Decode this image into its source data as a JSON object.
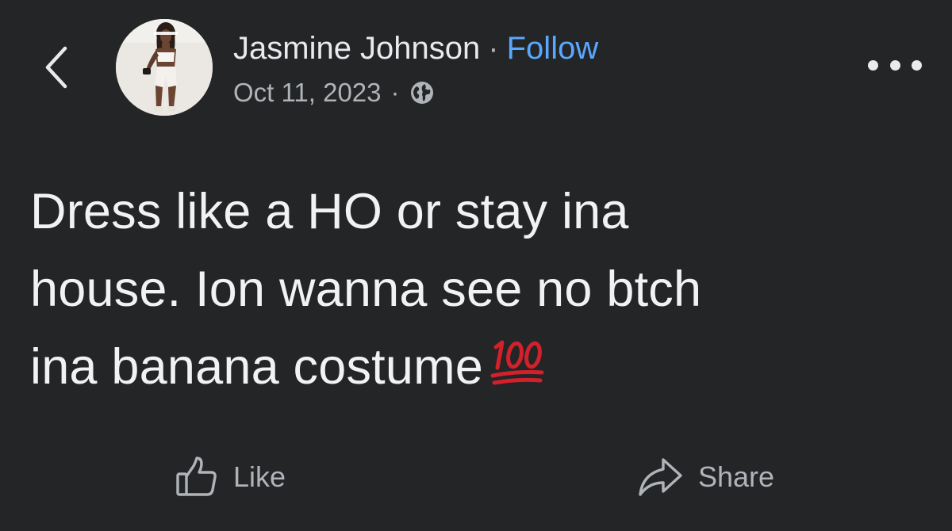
{
  "post": {
    "author_name": "Jasmine Johnson",
    "separator": "·",
    "follow_label": "Follow",
    "date": "Oct 11, 2023",
    "privacy_icon": "globe-icon",
    "text_line_1": "Dress like a HO or stay ina",
    "text_line_2": "house. Ion wanna see no btch",
    "text_line_3": "ina banana costume",
    "emoji_icon": "hundred-points-icon"
  },
  "header": {
    "back_icon": "chevron-left-icon",
    "more_icon": "more-horizontal-icon"
  },
  "actions": {
    "like_label": "Like",
    "share_label": "Share",
    "like_icon": "thumbs-up-icon",
    "share_icon": "share-arrow-icon"
  },
  "colors": {
    "background": "#232527",
    "text_primary": "#e8eaed",
    "text_secondary": "#b0b3b8",
    "link": "#5aa7ff",
    "emoji_red": "#d4202a"
  }
}
